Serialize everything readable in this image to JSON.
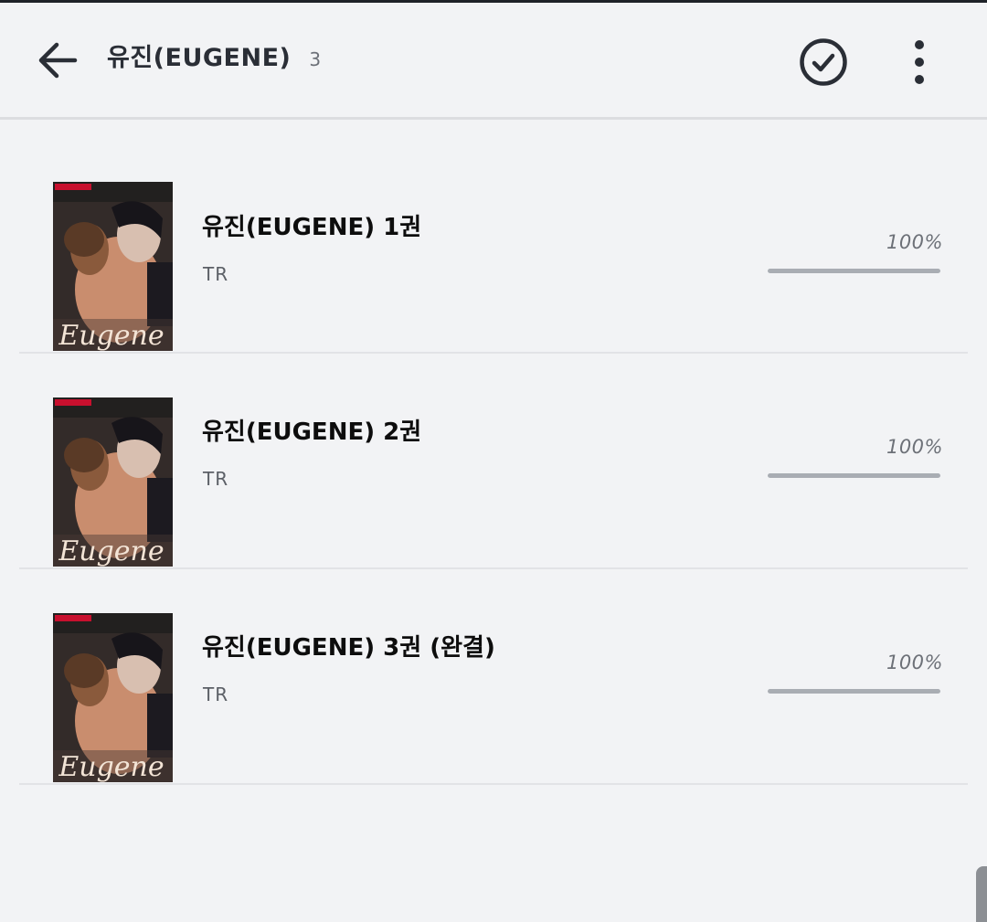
{
  "header": {
    "title": "유진(EUGENE)",
    "count": "3",
    "back_icon": "arrow-left-icon",
    "select_icon": "check-circle-icon",
    "more_icon": "more-vertical-icon"
  },
  "books": [
    {
      "title": "유진(EUGENE) 1권",
      "author": "TR",
      "percent_label": "100%",
      "progress": 1.0,
      "cover_text": "Eugene"
    },
    {
      "title": "유진(EUGENE) 2권",
      "author": "TR",
      "percent_label": "100%",
      "progress": 1.0,
      "cover_text": "Eugene"
    },
    {
      "title": "유진(EUGENE) 3권 (완결)",
      "author": "TR",
      "percent_label": "100%",
      "progress": 1.0,
      "cover_text": "Eugene"
    }
  ],
  "colors": {
    "background": "#f2f3f5",
    "icon": "#2a2e36",
    "progress_track": "#d9dbde",
    "progress_fill": "#a9adb3",
    "cover_banner": "#c8102e"
  }
}
